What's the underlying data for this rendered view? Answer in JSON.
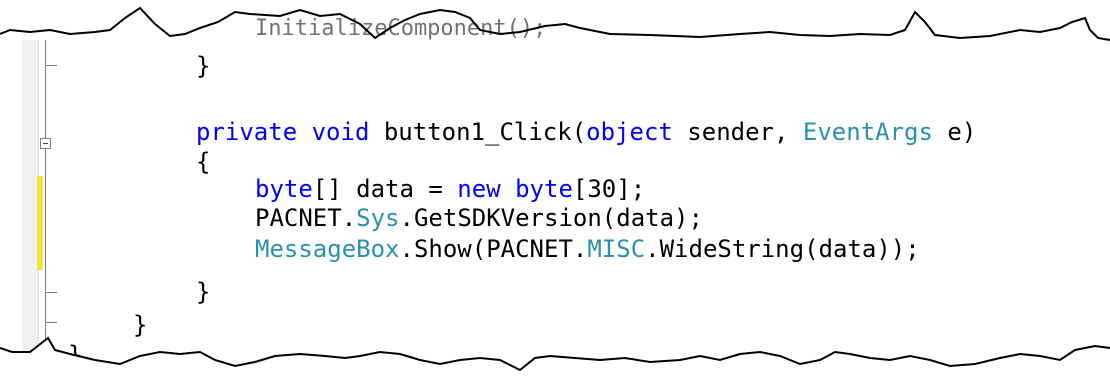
{
  "code": {
    "lines": [
      {
        "segments": [
          {
            "text": "}",
            "style": "plain"
          }
        ]
      },
      {
        "segments": [
          {
            "text": "private",
            "style": "kw"
          },
          {
            "text": " ",
            "style": "plain"
          },
          {
            "text": "void",
            "style": "kw"
          },
          {
            "text": " button1_Click(",
            "style": "plain"
          },
          {
            "text": "object",
            "style": "kw"
          },
          {
            "text": " sender, ",
            "style": "plain"
          },
          {
            "text": "EventArgs",
            "style": "type"
          },
          {
            "text": " e)",
            "style": "plain"
          }
        ]
      },
      {
        "segments": [
          {
            "text": "{",
            "style": "plain"
          }
        ]
      },
      {
        "segments": [
          {
            "text": "byte",
            "style": "kw"
          },
          {
            "text": "[] data = ",
            "style": "plain"
          },
          {
            "text": "new",
            "style": "kw"
          },
          {
            "text": " ",
            "style": "plain"
          },
          {
            "text": "byte",
            "style": "kw"
          },
          {
            "text": "[30];",
            "style": "plain"
          }
        ]
      },
      {
        "segments": [
          {
            "text": "PACNET.",
            "style": "plain"
          },
          {
            "text": "Sys",
            "style": "type"
          },
          {
            "text": ".GetSDKVersion(data);",
            "style": "plain"
          }
        ]
      },
      {
        "segments": [
          {
            "text": "MessageBox",
            "style": "type"
          },
          {
            "text": ".Show(PACNET.",
            "style": "plain"
          },
          {
            "text": "MISC",
            "style": "type"
          },
          {
            "text": ".WideString(data));",
            "style": "plain"
          }
        ]
      },
      {
        "segments": [
          {
            "text": "}",
            "style": "plain"
          }
        ]
      },
      {
        "segments": [
          {
            "text": "}",
            "style": "plain"
          }
        ]
      },
      {
        "segments": [
          {
            "text": "}",
            "style": "plain"
          }
        ]
      }
    ],
    "torn_top_text": "InitializeComponent();",
    "colors": {
      "keyword": "#0000ff",
      "type": "#2b91af",
      "text": "#000000",
      "change_bar": "#f3e33d",
      "gutter": "#f0f0f0"
    }
  }
}
